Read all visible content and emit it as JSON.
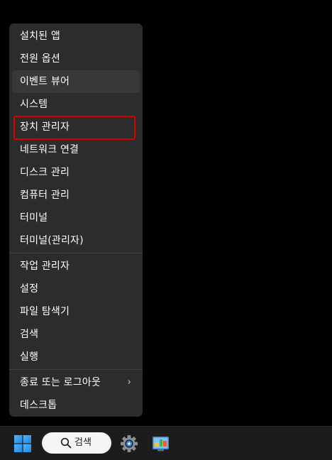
{
  "menu": {
    "items": [
      {
        "label": "설치된 앱"
      },
      {
        "label": "전원 옵션"
      },
      {
        "label": "이벤트 뷰어"
      },
      {
        "label": "시스템"
      },
      {
        "label": "장치 관리자"
      },
      {
        "label": "네트워크 연결"
      },
      {
        "label": "디스크 관리"
      },
      {
        "label": "컴퓨터 관리"
      },
      {
        "label": "터미널"
      },
      {
        "label": "터미널(관리자)"
      },
      {
        "label": "작업 관리자"
      },
      {
        "label": "설정"
      },
      {
        "label": "파일 탐색기"
      },
      {
        "label": "검색"
      },
      {
        "label": "실행"
      },
      {
        "label": "종료 또는 로그아웃",
        "submenu_indicator": "›"
      },
      {
        "label": "데스크톱"
      }
    ],
    "hovered_item": "이벤트 뷰어",
    "highlighted_item": "장치 관리자",
    "highlight_color": "#d90000"
  },
  "taskbar": {
    "start_icon": "windows-logo-icon",
    "search": {
      "label": "검색",
      "icon": "search-icon"
    },
    "pinned": [
      {
        "icon": "settings-gear-icon"
      },
      {
        "icon": "control-panel-icon"
      }
    ]
  },
  "colors": {
    "menu_bg": "#2c2c2c",
    "menu_hover": "#383838",
    "taskbar_bg": "#1c1c1c",
    "text": "#ffffff",
    "windows_blue": "#3aa0f0"
  }
}
